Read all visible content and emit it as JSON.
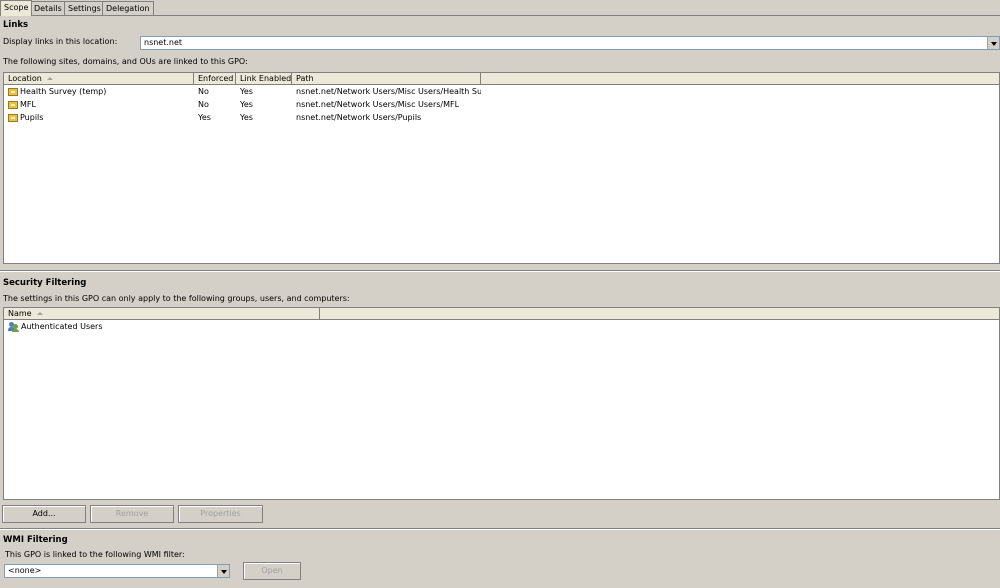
{
  "tabs": [
    {
      "label": "Scope",
      "active": true
    },
    {
      "label": "Details",
      "active": false
    },
    {
      "label": "Settings",
      "active": false
    },
    {
      "label": "Delegation",
      "active": false
    }
  ],
  "links": {
    "title": "Links",
    "location_label": "Display links in this location:",
    "location_value": "nsnet.net",
    "description": "The following sites, domains, and OUs are linked to this GPO:",
    "columns": [
      "Location",
      "Enforced",
      "Link Enabled",
      "Path"
    ],
    "rows": [
      {
        "location": "Health Survey (temp)",
        "enforced": "No",
        "link_enabled": "Yes",
        "path": "nsnet.net/Network Users/Misc Users/Health Su..."
      },
      {
        "location": "MFL",
        "enforced": "No",
        "link_enabled": "Yes",
        "path": "nsnet.net/Network Users/Misc Users/MFL"
      },
      {
        "location": "Pupils",
        "enforced": "Yes",
        "link_enabled": "Yes",
        "path": "nsnet.net/Network Users/Pupils"
      }
    ]
  },
  "security": {
    "title": "Security Filtering",
    "description": "The settings in this GPO can only apply to the following groups, users, and computers:",
    "columns": [
      "Name"
    ],
    "rows": [
      {
        "name": "Authenticated Users"
      }
    ],
    "buttons": {
      "add": "Add...",
      "remove": "Remove",
      "properties": "Properties"
    }
  },
  "wmi": {
    "title": "WMI Filtering",
    "description": "This GPO is linked to the following WMI filter:",
    "filter_value": "<none>",
    "open_button": "Open"
  },
  "icons": {
    "ou_row": "folder-ou-icon",
    "user_group_row": "user-group-icon",
    "dropdown": "chevron-down-icon"
  },
  "colors": {
    "panel": "#d4d0c8",
    "list_bg": "#ffffff",
    "header_bg": "#ece9d8"
  }
}
